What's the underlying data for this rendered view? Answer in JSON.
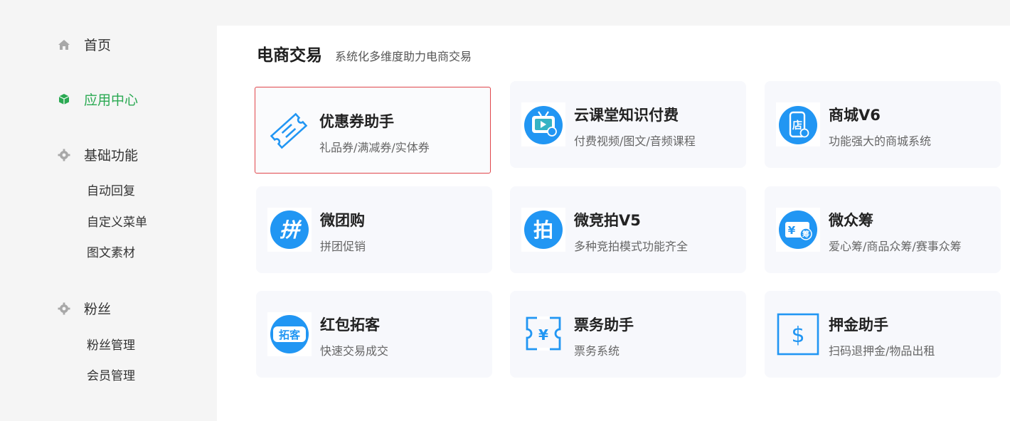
{
  "sidebar": {
    "home": {
      "label": "首页",
      "icon": "home-icon"
    },
    "app_center": {
      "label": "应用中心",
      "icon": "cube-icon",
      "color": "#2aa952"
    },
    "basic": {
      "label": "基础功能",
      "icon": "gear-icon",
      "items": [
        "自动回复",
        "自定义菜单",
        "图文素材"
      ]
    },
    "fans": {
      "label": "粉丝",
      "icon": "gear-icon",
      "items": [
        "粉丝管理",
        "会员管理"
      ]
    }
  },
  "section": {
    "title": "电商交易",
    "subtitle": "系统化多维度助力电商交易"
  },
  "cards": [
    {
      "name": "优惠券助手",
      "desc": "礼品券/满减券/实体券",
      "icon": "coupon-icon",
      "selected": true
    },
    {
      "name": "云课堂知识付费",
      "desc": "付费视频/图文/音频课程",
      "icon": "tv-icon"
    },
    {
      "name": "商城V6",
      "desc": "功能强大的商城系统",
      "icon": "phone-shop-icon",
      "badge": "店"
    },
    {
      "name": "微团购",
      "desc": "拼团促销",
      "icon": "group-buy-icon",
      "badge": "拼"
    },
    {
      "name": "微竞拍V5",
      "desc": "多种竞拍模式功能齐全",
      "icon": "auction-icon",
      "badge": "拍"
    },
    {
      "name": "微众筹",
      "desc": "爱心筹/商品众筹/赛事众筹",
      "icon": "crowdfund-icon",
      "badge": "¥筹"
    },
    {
      "name": "红包拓客",
      "desc": "快速交易成交",
      "icon": "red-packet-icon",
      "badge": "拓客"
    },
    {
      "name": "票务助手",
      "desc": "票务系统",
      "icon": "ticket-icon",
      "badge": "¥"
    },
    {
      "name": "押金助手",
      "desc": "扫码退押金/物品出租",
      "icon": "deposit-icon",
      "badge": "$"
    }
  ],
  "colors": {
    "accent_blue": "#2196f3",
    "active_green": "#2aa952",
    "selected_border": "#e0464b"
  }
}
